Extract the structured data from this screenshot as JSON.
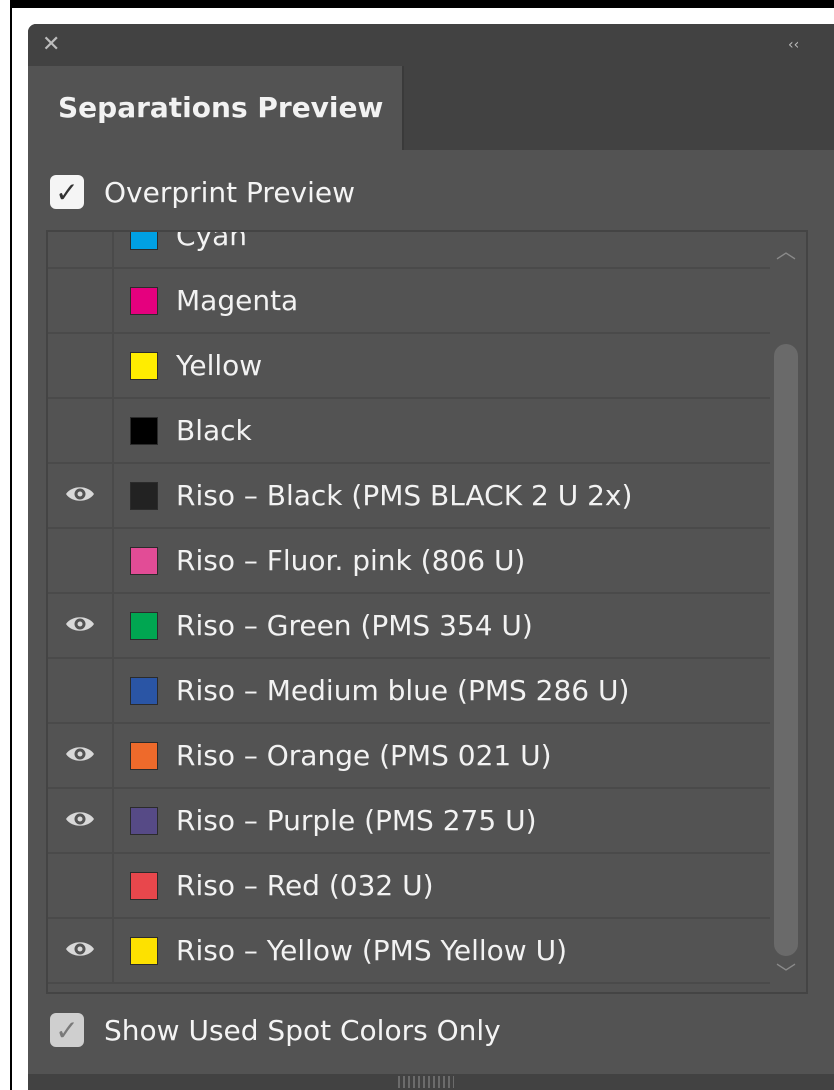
{
  "panel": {
    "close_icon_glyph": "✕",
    "collapse_icon_glyph": "‹‹",
    "tab_title": "Separations Preview"
  },
  "overprint": {
    "label": "Overprint Preview",
    "checked": true
  },
  "show_used": {
    "label": "Show Used Spot Colors Only",
    "checked": true
  },
  "separations": [
    {
      "name": "Cyan",
      "color": "#00a0e3",
      "visible": false
    },
    {
      "name": "Magenta",
      "color": "#e5007e",
      "visible": false
    },
    {
      "name": "Yellow",
      "color": "#ffed00",
      "visible": false
    },
    {
      "name": "Black",
      "color": "#000000",
      "visible": false
    },
    {
      "name": "Riso – Black (PMS BLACK 2 U 2x)",
      "color": "#222222",
      "visible": true
    },
    {
      "name": "Riso – Fluor. pink (806 U)",
      "color": "#e24c96",
      "visible": false
    },
    {
      "name": "Riso – Green (PMS 354 U)",
      "color": "#00a651",
      "visible": true
    },
    {
      "name": "Riso – Medium blue (PMS 286 U)",
      "color": "#2a55a5",
      "visible": false
    },
    {
      "name": "Riso – Orange (PMS 021 U)",
      "color": "#ee6a2b",
      "visible": true
    },
    {
      "name": "Riso – Purple (PMS 275 U)",
      "color": "#564a86",
      "visible": true
    },
    {
      "name": "Riso – Red (032 U)",
      "color": "#e8474c",
      "visible": false
    },
    {
      "name": "Riso – Yellow (PMS Yellow U)",
      "color": "#fde100",
      "visible": true
    }
  ],
  "scroll": {
    "up_glyph": "︿",
    "down_glyph": "﹀"
  }
}
